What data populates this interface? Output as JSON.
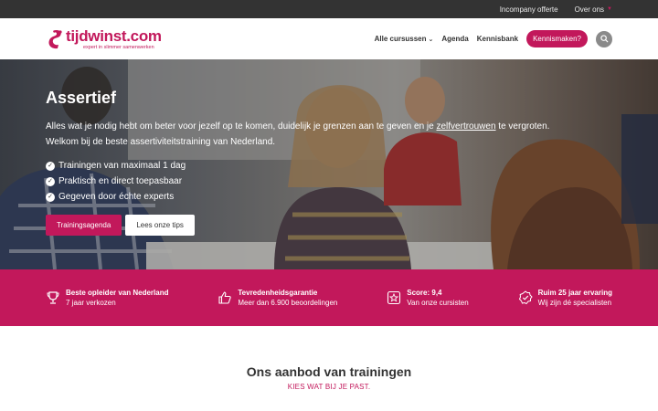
{
  "topbar": {
    "links": [
      {
        "label": "Incompany offerte"
      },
      {
        "label": "Over ons"
      }
    ]
  },
  "header": {
    "logo_name": "tijdwinst.com",
    "logo_tagline": "expert in slimmer samenwerken",
    "nav": [
      {
        "label": "Alle cursussen",
        "has_dropdown": true
      },
      {
        "label": "Agenda"
      },
      {
        "label": "Kennisbank"
      }
    ],
    "cta_label": "Kennismaken?",
    "search_icon": "search-icon"
  },
  "hero": {
    "title": "Assertief",
    "intro_before": "Alles wat je nodig hebt om beter voor jezelf op te komen, duidelijk je grenzen aan te geven en je ",
    "intro_link": "zelfvertrouwen",
    "intro_after": " te vergroten.",
    "intro_line2": "Welkom bij de beste assertiviteitstraining van Nederland.",
    "checks": [
      "Trainingen van maximaal 1 dag",
      "Praktisch en direct toepasbaar",
      "Gegeven door échte experts"
    ],
    "primary_button": "Trainingsagenda",
    "secondary_button": "Lees onze tips"
  },
  "usp": [
    {
      "icon": "trophy-icon",
      "title": "Beste opleider van Nederland",
      "sub": "7 jaar verkozen"
    },
    {
      "icon": "thumbs-up-icon",
      "title": "Tevredenheidsgarantie",
      "sub": "Meer dan 6.900 beoordelingen"
    },
    {
      "icon": "star-icon",
      "title": "Score: 9,4",
      "sub": "Van onze cursisten"
    },
    {
      "icon": "badge-check-icon",
      "title": "Ruim 25 jaar ervaring",
      "sub": "Wij zijn dé specialisten"
    }
  ],
  "offer": {
    "title": "Ons aanbod van trainingen",
    "subtitle": "KIES WAT BIJ JE PAST."
  },
  "colors": {
    "brand": "#c2185b",
    "topbar": "#333333"
  }
}
